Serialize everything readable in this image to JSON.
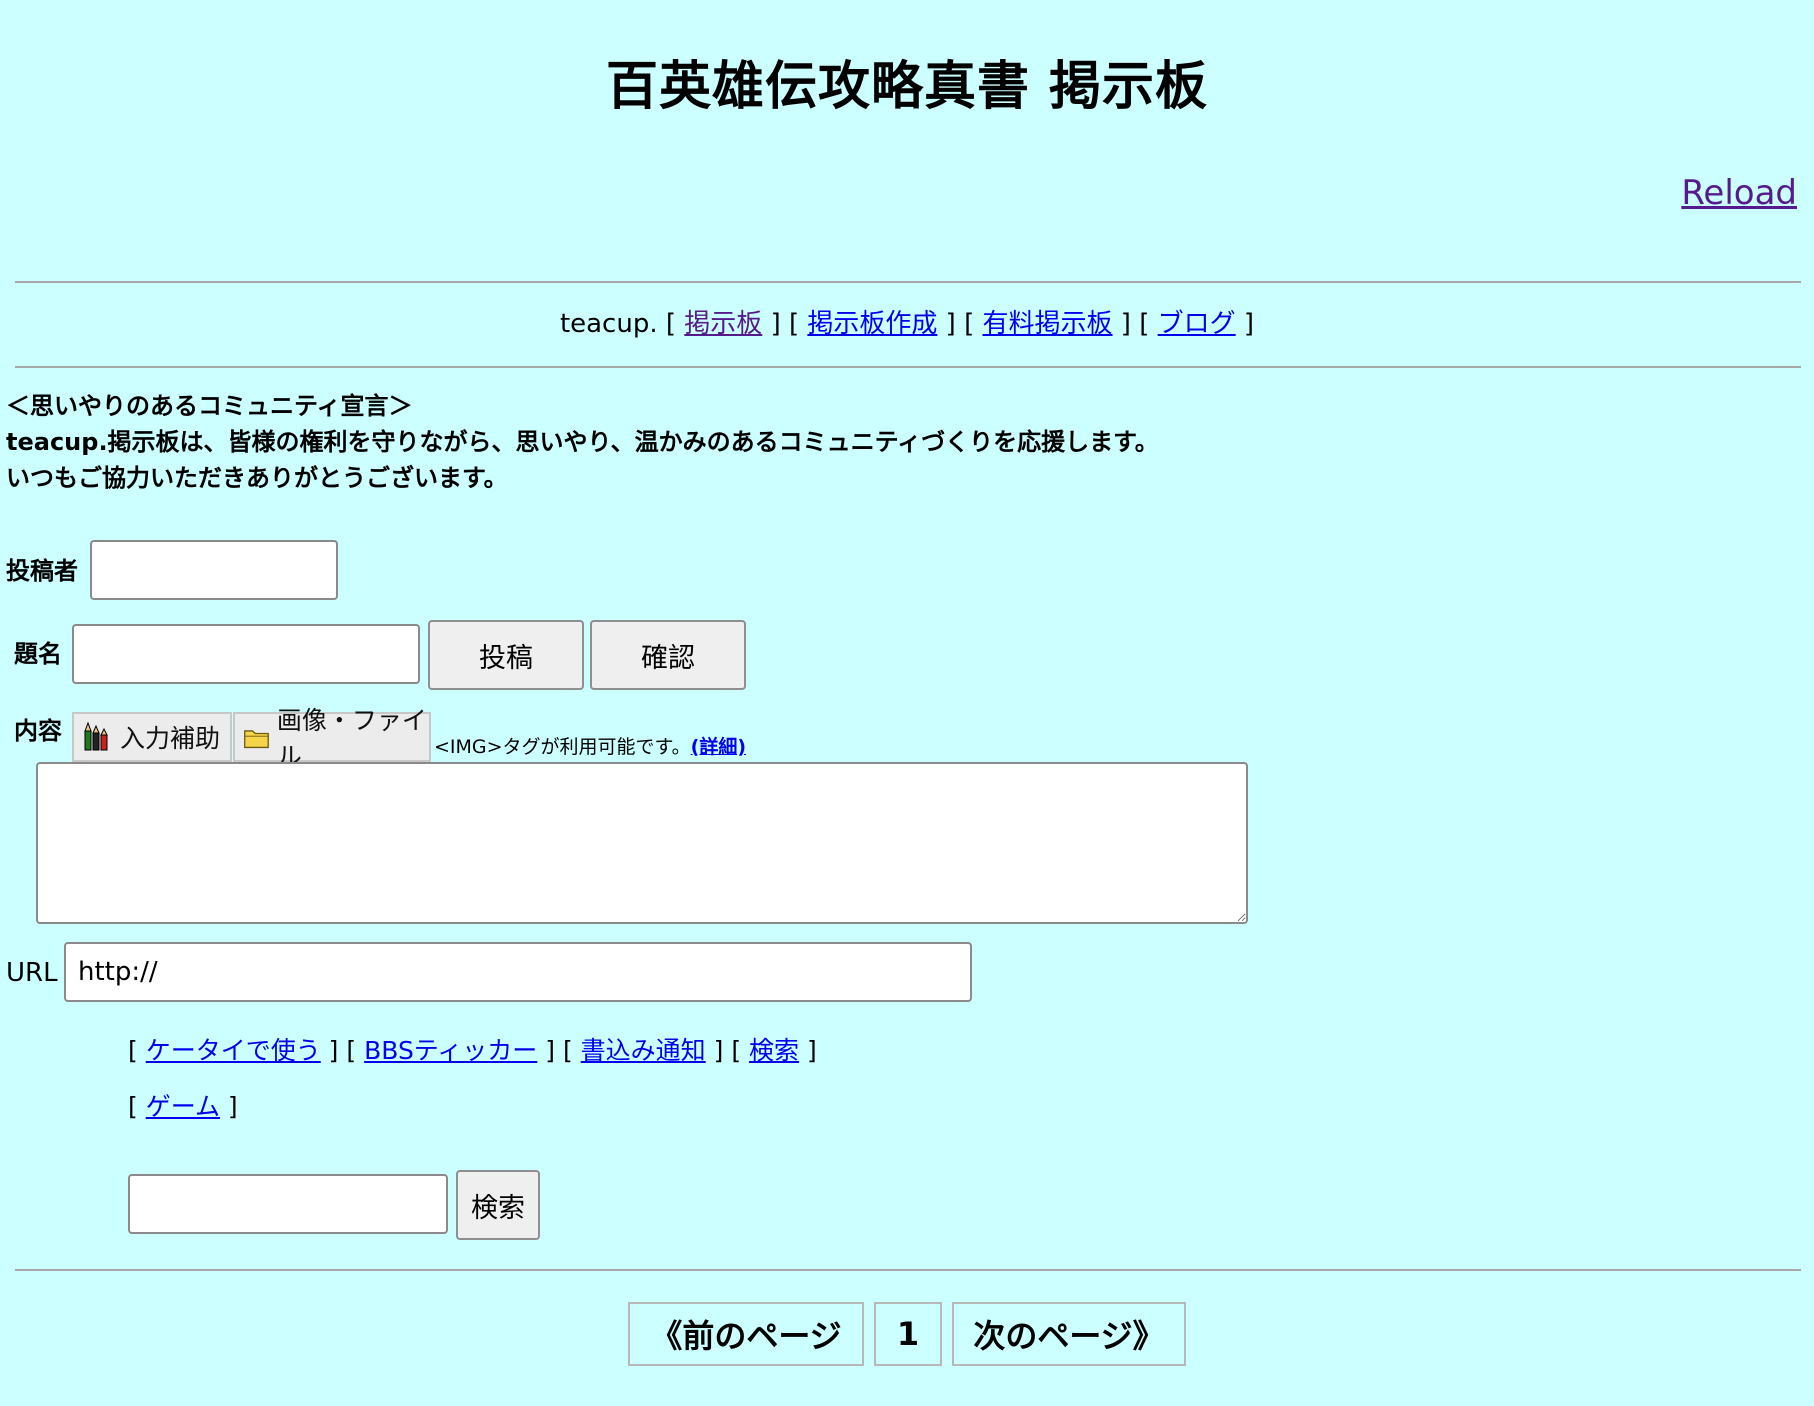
{
  "header": {
    "title": "百英雄伝攻略真書 掲示板",
    "reload_label": "Reload"
  },
  "teacup_nav": {
    "prefix": "teacup.",
    "links": [
      "掲示板",
      "掲示板作成",
      "有料掲示板",
      "ブログ"
    ]
  },
  "declaration": {
    "heading": "＜思いやりのあるコミュニティ宣言＞",
    "line1": "teacup.掲示板は、皆様の権利を守りながら、思いやり、温かみのあるコミュニティづくりを応援します。",
    "line2": "いつもご協力いただきありがとうございます。"
  },
  "form": {
    "author_label": "投稿者",
    "author_value": "",
    "subject_label": "題名",
    "subject_value": "",
    "post_button": "投稿",
    "confirm_button": "確認",
    "content_label": "内容",
    "input_assist_button": "入力補助",
    "image_file_button": "画像・ファイル",
    "img_note": "<IMG>タグが利用可能です。",
    "img_note_link": "(詳細)",
    "content_value": "",
    "url_label": "URL",
    "url_value": "http://"
  },
  "utility_links": {
    "row1": [
      "ケータイで使う",
      "BBSティッカー",
      "書込み通知",
      "検索"
    ],
    "row2": [
      "ゲーム"
    ]
  },
  "search": {
    "value": "",
    "button": "検索"
  },
  "pager": {
    "prev": "《前のページ",
    "current": "1",
    "next": "次のページ》"
  },
  "colors": {
    "background": "#ccffff",
    "link": "#0000ee",
    "visited_link": "#551a8b"
  }
}
